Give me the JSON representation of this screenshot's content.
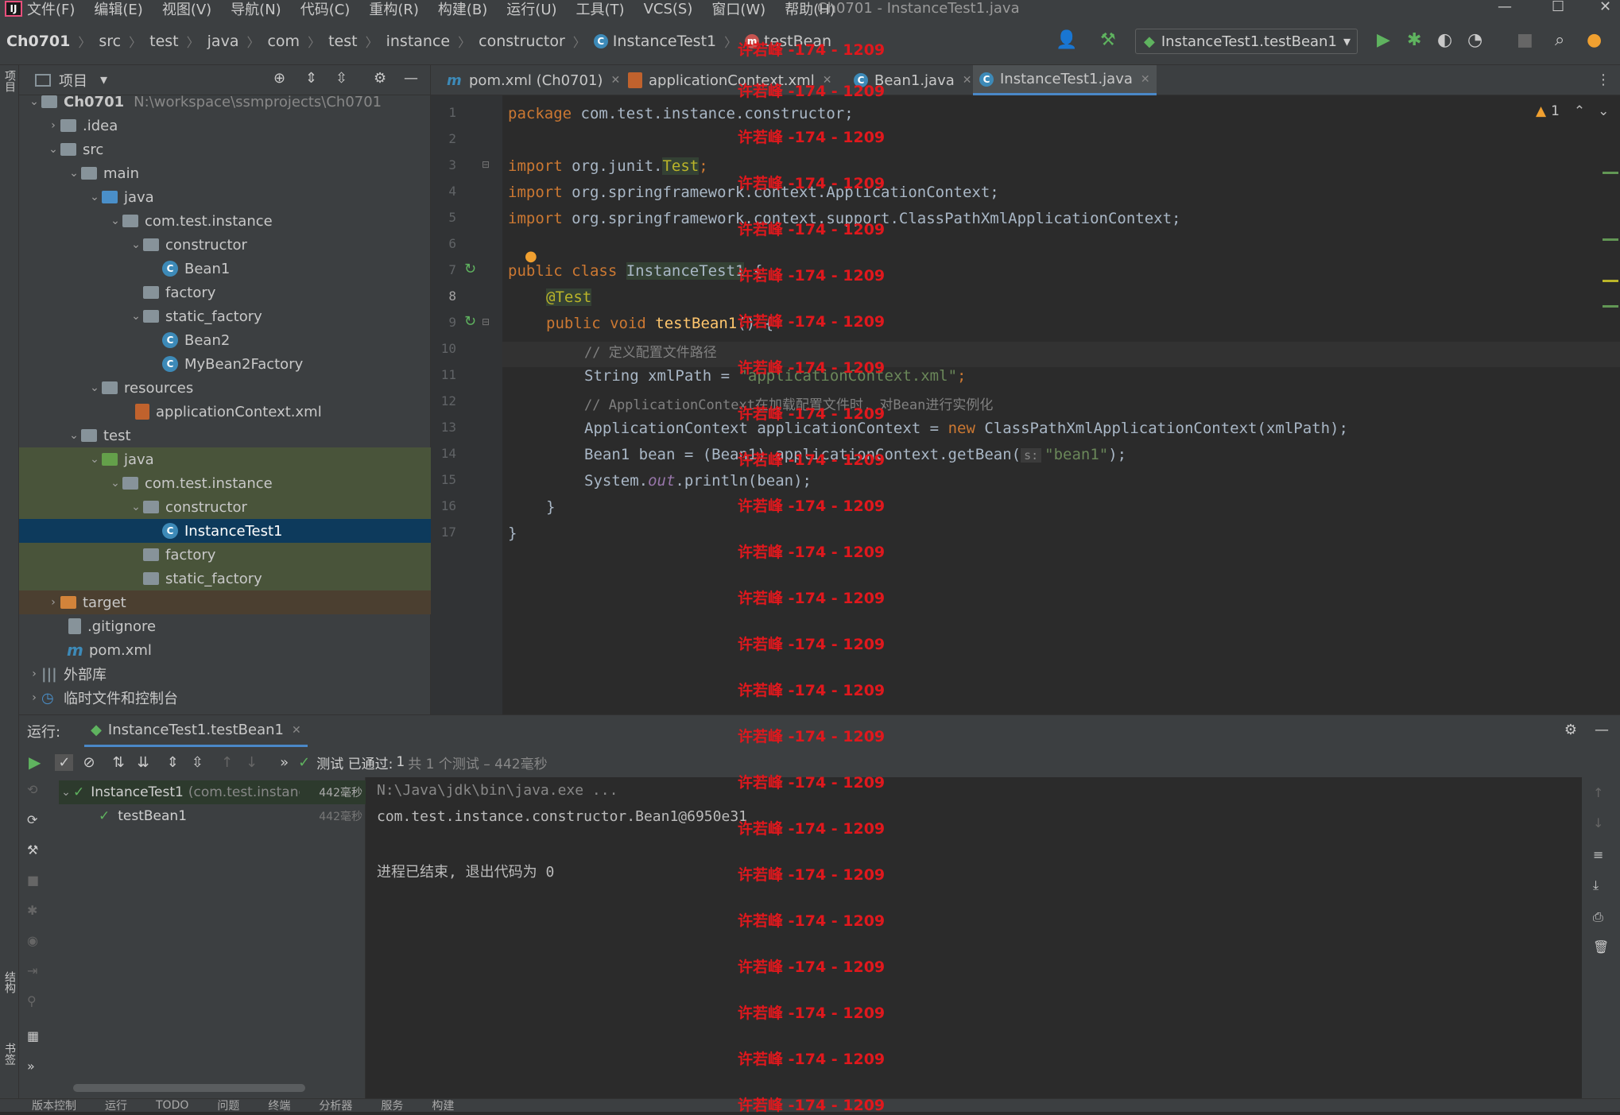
{
  "menu": {
    "items": [
      "文件(F)",
      "编辑(E)",
      "视图(V)",
      "导航(N)",
      "代码(C)",
      "重构(R)",
      "构建(B)",
      "运行(U)",
      "工具(T)",
      "VCS(S)",
      "窗口(W)",
      "帮助(H)"
    ],
    "window_title": "Ch0701 - InstanceTest1.java"
  },
  "breadcrumb": [
    "Ch0701",
    "src",
    "test",
    "java",
    "com",
    "test",
    "instance",
    "constructor",
    "InstanceTest1",
    "testBean"
  ],
  "run_config": "InstanceTest1.testBean1",
  "project_panel": {
    "title": "项目",
    "root_name": "Ch0701",
    "root_path": "N:\\workspace\\ssmprojects\\Ch0701",
    "nodes": [
      ".idea",
      "src",
      "main",
      "java",
      "com.test.instance",
      "constructor",
      "Bean1",
      "factory",
      "static_factory",
      "Bean2",
      "MyBean2Factory",
      "resources",
      "applicationContext.xml",
      "test",
      "java",
      "com.test.instance",
      "constructor",
      "InstanceTest1",
      "factory",
      "static_factory",
      "target",
      ".gitignore",
      "pom.xml",
      "外部库",
      "临时文件和控制台"
    ]
  },
  "tabs": [
    "pom.xml (Ch0701)",
    "applicationContext.xml",
    "Bean1.java",
    "InstanceTest1.java"
  ],
  "warnings_count": "1",
  "code": {
    "line_numbers": [
      "1",
      "2",
      "3",
      "4",
      "5",
      "6",
      "7",
      "8",
      "9",
      "10",
      "11",
      "12",
      "13",
      "14",
      "15",
      "16",
      "17"
    ],
    "l1_kw": "package",
    "l1_rest": " com.test.instance.constructor;",
    "l3_kw": "import",
    "l3_a": " org.junit.",
    "l3_an": "Test",
    "l3_end": ";",
    "l4_kw": "import",
    "l4_rest": " org.springframework.context.ApplicationContext;",
    "l5_kw": "import",
    "l5_rest": " org.springframework.context.support.ClassPathXmlApplicationContext;",
    "l7_kw": "public class",
    "l7_cls": "InstanceTest1",
    "l7_end": " {",
    "l8_an": "@Test",
    "l9_kw": "public void",
    "l9_fn": "testBean1",
    "l9_end": "() {",
    "l10_cm": "// 定义配置文件路径",
    "l11_a": "String xmlPath = ",
    "l11_str": "\"applicationContext.xml\"",
    "l11_end": ";",
    "l12_cm": "// ApplicationContext在加载配置文件时, 对Bean进行实例化",
    "l13_a": "ApplicationContext applicationContext = ",
    "l13_kw": "new",
    "l13_b": " ClassPathXmlApplicationContext(xmlPath);",
    "l14_a": "Bean1 bean = (Bean1) applicationContext.getBean(",
    "l14_hint": "s:",
    "l14_str": "\"bean1\"",
    "l14_end": ");",
    "l15_a": "System.",
    "l15_fld": "out",
    "l15_b": ".println(bean);",
    "l16": "}",
    "l17": "}"
  },
  "watermark": "许若峰 -174 - 1209",
  "run_panel": {
    "label": "运行:",
    "tab": "InstanceTest1.testBean1",
    "status_prefix": "测试 已通过:",
    "status_count": "1",
    "status_rest": "共 1 个测试 – 442毫秒",
    "tree": [
      {
        "name": "InstanceTest1",
        "pkg": "(com.test.instanc",
        "time": "442毫秒"
      },
      {
        "name": "testBean1",
        "pkg": "",
        "time": "442毫秒"
      }
    ],
    "console": [
      "N:\\Java\\jdk\\bin\\java.exe ...",
      "com.test.instance.constructor.Bean1@6950e31",
      "",
      "进程已结束, 退出代码为 0"
    ]
  },
  "statusbar": [
    "版本控制",
    "运行",
    "TODO",
    "问题",
    "终端",
    "分析器",
    "服务",
    "构建"
  ],
  "left_strip": [
    "项目",
    "结构",
    "书签"
  ],
  "colors": {
    "accent": "#4a88c7",
    "watermark": "#e0181d",
    "selection": "#0d3a5c",
    "test_root": "#49543a"
  }
}
